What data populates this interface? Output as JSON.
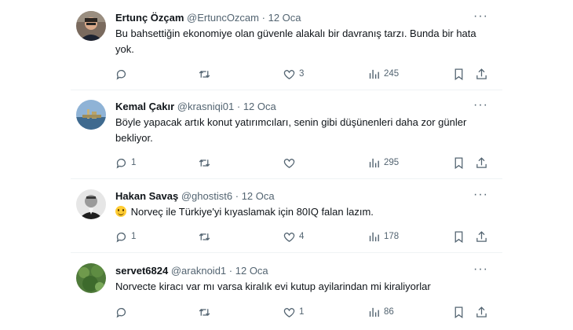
{
  "tweets": [
    {
      "name": "Ertunç Özçam",
      "handle": "@ErtuncOzcam",
      "sep": "·",
      "date": "12 Oca",
      "text": "Bu bahsettiğin ekonomiye olan güvenle alakalı bir davranış tarzı. Bunda bir hata yok.",
      "reply_count": "",
      "retweet_count": "",
      "like_count": "3",
      "view_count": "245"
    },
    {
      "name": "Kemal Çakır",
      "handle": "@krasniqi01",
      "sep": "·",
      "date": "12 Oca",
      "text": "Böyle yapacak artık konut yatırımcıları, senin gibi düşünenleri daha zor günler bekliyor.",
      "reply_count": "1",
      "retweet_count": "",
      "like_count": "",
      "view_count": "295"
    },
    {
      "name": "Hakan Savaş",
      "handle": "@ghostist6",
      "sep": "·",
      "date": "12 Oca",
      "text": "Norveç ile Türkiye'yi kıyaslamak için 80IQ falan lazım.",
      "emoji": "smiling-face-emoji",
      "reply_count": "1",
      "retweet_count": "",
      "like_count": "4",
      "view_count": "178"
    },
    {
      "name": "servet6824",
      "handle": "@araknoid1",
      "sep": "·",
      "date": "12 Oca",
      "text": "Norvecte kiracı var mı varsa kiralık evi kutup ayilarindan mi kiraliyorlar",
      "reply_count": "",
      "retweet_count": "",
      "like_count": "1",
      "view_count": "86"
    }
  ],
  "more_label": "···",
  "colors": {
    "text": "#0f1419",
    "secondary": "#536471",
    "divider": "#eff3f4"
  }
}
